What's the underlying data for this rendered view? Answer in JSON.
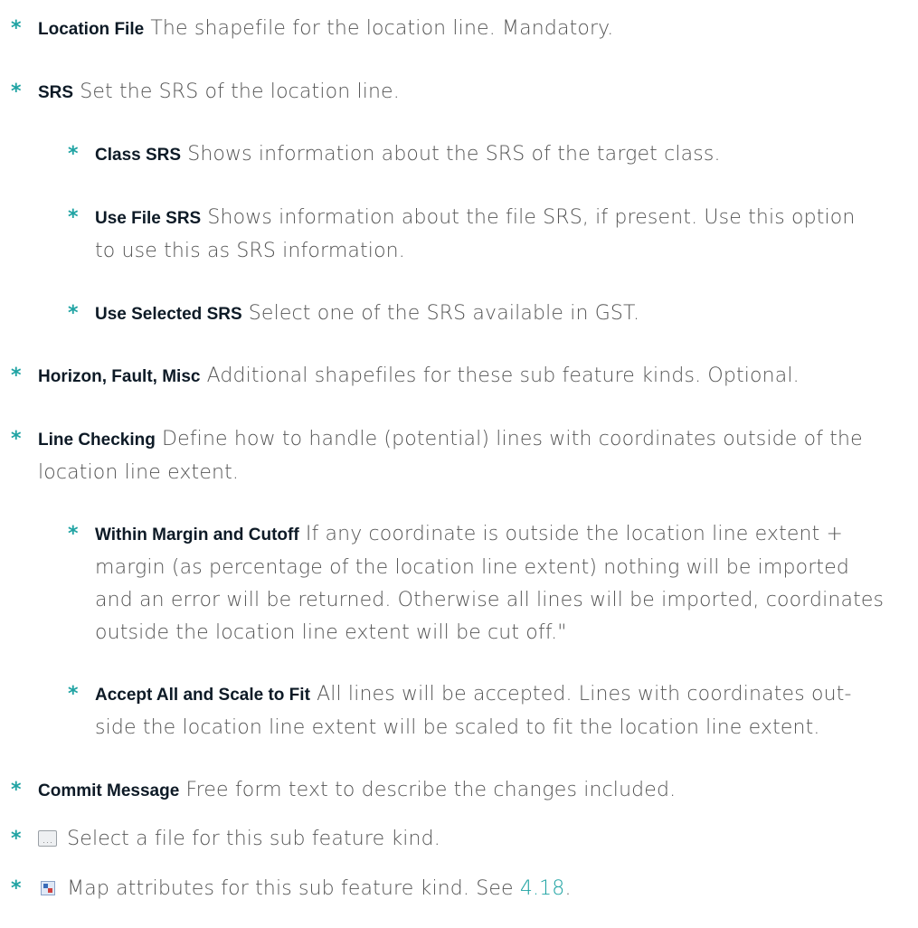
{
  "items": {
    "location_file": {
      "term": "Location File",
      "text": "The shapefile for the location line. Mandatory."
    },
    "srs": {
      "term": "SRS",
      "text": "Set the SRS of the location line."
    },
    "class_srs": {
      "term": "Class SRS",
      "text": "Shows information about the SRS of the target class."
    },
    "use_file_srs": {
      "term": "Use File SRS",
      "text_line1": "Shows information about the file SRS, if present. Use this option",
      "text_line2": "to use this as SRS information."
    },
    "use_selected_srs": {
      "term": "Use Selected SRS",
      "text": "Select one of the SRS available in GST."
    },
    "horizon_fault_misc": {
      "term": "Horizon, Fault, Misc",
      "text": "Additional shapefiles for these sub feature kinds. Optional."
    },
    "line_checking": {
      "term": "Line Checking",
      "text_line1": "Define how to handle (potential) lines with coordinates outside of the",
      "text_line2": "location line extent."
    },
    "within_margin": {
      "term": "Within Margin and Cutoff",
      "text_line1": "If any coordinate is outside the location line extent +",
      "text_line2": "margin (as percentage of the location line extent) nothing will be imported",
      "text_line3": "and an error will be returned. Otherwise all lines will be imported, coordinates",
      "text_line4": "outside the location line extent will be cut off.\""
    },
    "accept_all": {
      "term": "Accept All and Scale to Fit",
      "text_line1": "All lines will be accepted. Lines with coordinates out-",
      "text_line2": "side the location line extent will be scaled to fit the location line extent."
    },
    "commit_message": {
      "term": "Commit Message",
      "text": "Free form text to describe the changes included."
    },
    "file_button": {
      "icon_label": "...",
      "icon": "ellipsis-button-icon",
      "text": "Select a file for this sub feature kind."
    },
    "map_attributes": {
      "icon": "map-attributes-icon",
      "text": "Map attributes for this sub feature kind. See",
      "ref": "4.18",
      "end": "."
    }
  },
  "bullet_symbol": "*",
  "colors": {
    "accent": "#1fa3a3",
    "term": "#0d1a26",
    "body": "#555555"
  }
}
